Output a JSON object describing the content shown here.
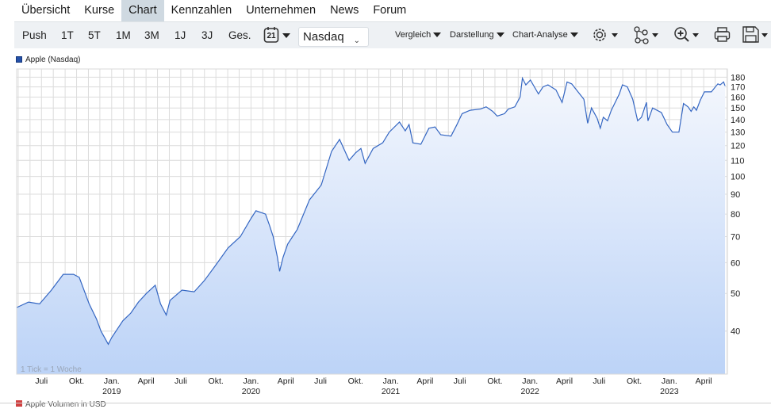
{
  "tabs": [
    "Übersicht",
    "Kurse",
    "Chart",
    "Kennzahlen",
    "Unternehmen",
    "News",
    "Forum"
  ],
  "active_tab": "Chart",
  "toolbar": {
    "periods": [
      "Push",
      "1T",
      "5T",
      "1M",
      "3M",
      "1J",
      "3J",
      "Ges."
    ],
    "calendar_day": "21",
    "exchange": "Nasdaq",
    "menus": [
      "Vergleich",
      "Darstellung",
      "Chart-Analyse"
    ],
    "icons": [
      "gear-icon",
      "network-icon",
      "zoom-in-icon",
      "print-icon",
      "save-icon"
    ]
  },
  "legend": {
    "series": "Apple (Nasdaq)",
    "volume": "Apple Volumen in USD"
  },
  "colors": {
    "line": "#3466c2",
    "fill_top": "#f4f7fd",
    "fill_bottom": "#bcd3f7",
    "grid": "#dcdcdc",
    "active_tab": "#cfd9e1"
  },
  "chart_data": {
    "type": "area",
    "scale": "log",
    "ylim": [
      31,
      189
    ],
    "xlim": [
      "2018-04-27",
      "2023-06-02"
    ],
    "grid": true,
    "y_ticks": [
      40,
      50,
      60,
      70,
      80,
      90,
      100,
      110,
      120,
      130,
      140,
      150,
      160,
      170,
      180
    ],
    "x_ticks": [
      {
        "date": "2018-07-01",
        "label": "Juli",
        "year": ""
      },
      {
        "date": "2018-10-01",
        "label": "Okt.",
        "year": ""
      },
      {
        "date": "2019-01-01",
        "label": "Jan.",
        "year": "2019"
      },
      {
        "date": "2019-04-01",
        "label": "April",
        "year": ""
      },
      {
        "date": "2019-07-01",
        "label": "Juli",
        "year": ""
      },
      {
        "date": "2019-10-01",
        "label": "Okt.",
        "year": ""
      },
      {
        "date": "2020-01-01",
        "label": "Jan.",
        "year": "2020"
      },
      {
        "date": "2020-04-01",
        "label": "April",
        "year": ""
      },
      {
        "date": "2020-07-01",
        "label": "Juli",
        "year": ""
      },
      {
        "date": "2020-10-01",
        "label": "Okt.",
        "year": ""
      },
      {
        "date": "2021-01-01",
        "label": "Jan.",
        "year": "2021"
      },
      {
        "date": "2021-04-01",
        "label": "April",
        "year": ""
      },
      {
        "date": "2021-07-01",
        "label": "Juli",
        "year": ""
      },
      {
        "date": "2021-10-01",
        "label": "Okt.",
        "year": ""
      },
      {
        "date": "2022-01-01",
        "label": "Jan.",
        "year": "2022"
      },
      {
        "date": "2022-04-01",
        "label": "April",
        "year": ""
      },
      {
        "date": "2022-07-01",
        "label": "Juli",
        "year": ""
      },
      {
        "date": "2022-10-01",
        "label": "Okt.",
        "year": ""
      },
      {
        "date": "2023-01-01",
        "label": "Jan.",
        "year": "2023"
      },
      {
        "date": "2023-04-01",
        "label": "April",
        "year": ""
      }
    ],
    "note": "1 Tick = 1 Woche",
    "series": [
      {
        "name": "Apple (Nasdaq)",
        "points": [
          [
            "2018-04-27",
            46
          ],
          [
            "2018-05-28",
            47.5
          ],
          [
            "2018-06-26",
            47
          ],
          [
            "2018-07-27",
            51
          ],
          [
            "2018-08-27",
            56
          ],
          [
            "2018-09-23",
            56
          ],
          [
            "2018-10-08",
            55
          ],
          [
            "2018-11-03",
            47
          ],
          [
            "2018-11-22",
            43
          ],
          [
            "2018-12-04",
            40
          ],
          [
            "2018-12-23",
            37
          ],
          [
            "2019-01-01",
            38.5
          ],
          [
            "2019-01-30",
            42.5
          ],
          [
            "2019-02-20",
            44.5
          ],
          [
            "2019-03-12",
            47.5
          ],
          [
            "2019-04-02",
            50
          ],
          [
            "2019-04-25",
            52.5
          ],
          [
            "2019-05-09",
            47
          ],
          [
            "2019-05-24",
            44
          ],
          [
            "2019-06-03",
            48
          ],
          [
            "2019-07-04",
            51
          ],
          [
            "2019-08-05",
            50.5
          ],
          [
            "2019-09-01",
            54
          ],
          [
            "2019-09-30",
            59
          ],
          [
            "2019-11-02",
            65.5
          ],
          [
            "2019-12-04",
            70
          ],
          [
            "2020-01-01",
            78
          ],
          [
            "2020-01-14",
            81.6
          ],
          [
            "2020-02-08",
            80
          ],
          [
            "2020-02-18",
            75
          ],
          [
            "2020-02-28",
            70
          ],
          [
            "2020-03-10",
            62
          ],
          [
            "2020-03-16",
            57
          ],
          [
            "2020-03-25",
            62
          ],
          [
            "2020-04-06",
            67
          ],
          [
            "2020-05-01",
            73
          ],
          [
            "2020-06-02",
            87
          ],
          [
            "2020-07-03",
            95
          ],
          [
            "2020-07-30",
            116
          ],
          [
            "2020-08-20",
            124.5
          ],
          [
            "2020-09-14",
            110
          ],
          [
            "2020-10-01",
            115
          ],
          [
            "2020-10-15",
            118
          ],
          [
            "2020-10-26",
            108
          ],
          [
            "2020-11-16",
            118
          ],
          [
            "2020-12-11",
            122
          ],
          [
            "2020-12-28",
            130
          ],
          [
            "2021-01-24",
            138
          ],
          [
            "2021-02-08",
            131
          ],
          [
            "2021-02-18",
            136
          ],
          [
            "2021-02-28",
            122
          ],
          [
            "2021-03-21",
            121
          ],
          [
            "2021-04-11",
            133
          ],
          [
            "2021-04-27",
            134
          ],
          [
            "2021-05-12",
            128
          ],
          [
            "2021-06-08",
            127
          ],
          [
            "2021-06-22",
            135
          ],
          [
            "2021-07-07",
            145
          ],
          [
            "2021-07-28",
            148
          ],
          [
            "2021-08-24",
            149
          ],
          [
            "2021-09-08",
            151
          ],
          [
            "2021-09-25",
            147
          ],
          [
            "2021-10-07",
            143
          ],
          [
            "2021-10-26",
            145
          ],
          [
            "2021-11-05",
            149
          ],
          [
            "2021-11-22",
            151
          ],
          [
            "2021-12-06",
            160
          ],
          [
            "2021-12-12",
            179
          ],
          [
            "2021-12-21",
            172
          ],
          [
            "2022-01-02",
            177
          ],
          [
            "2022-01-23",
            163
          ],
          [
            "2022-02-04",
            170
          ],
          [
            "2022-02-17",
            172
          ],
          [
            "2022-03-10",
            167
          ],
          [
            "2022-03-26",
            155
          ],
          [
            "2022-04-08",
            175
          ],
          [
            "2022-04-20",
            173
          ],
          [
            "2022-05-22",
            158
          ],
          [
            "2022-06-01",
            137
          ],
          [
            "2022-06-11",
            150
          ],
          [
            "2022-06-26",
            141
          ],
          [
            "2022-07-04",
            133
          ],
          [
            "2022-07-12",
            142
          ],
          [
            "2022-07-23",
            139
          ],
          [
            "2022-08-02",
            148
          ],
          [
            "2022-08-23",
            163
          ],
          [
            "2022-08-31",
            172
          ],
          [
            "2022-09-13",
            170
          ],
          [
            "2022-09-27",
            158
          ],
          [
            "2022-10-10",
            139
          ],
          [
            "2022-10-20",
            142
          ],
          [
            "2022-11-02",
            155
          ],
          [
            "2022-11-06",
            139
          ],
          [
            "2022-11-18",
            150
          ],
          [
            "2022-12-11",
            146
          ],
          [
            "2022-12-26",
            136
          ],
          [
            "2023-01-09",
            130
          ],
          [
            "2023-01-26",
            130
          ],
          [
            "2023-02-07",
            154
          ],
          [
            "2023-02-19",
            151
          ],
          [
            "2023-02-27",
            147
          ],
          [
            "2023-03-06",
            151
          ],
          [
            "2023-03-13",
            148
          ],
          [
            "2023-03-23",
            157
          ],
          [
            "2023-04-03",
            165
          ],
          [
            "2023-04-21",
            165
          ],
          [
            "2023-05-08",
            173
          ],
          [
            "2023-05-14",
            172
          ],
          [
            "2023-05-23",
            175
          ],
          [
            "2023-05-27",
            171
          ]
        ]
      }
    ]
  }
}
